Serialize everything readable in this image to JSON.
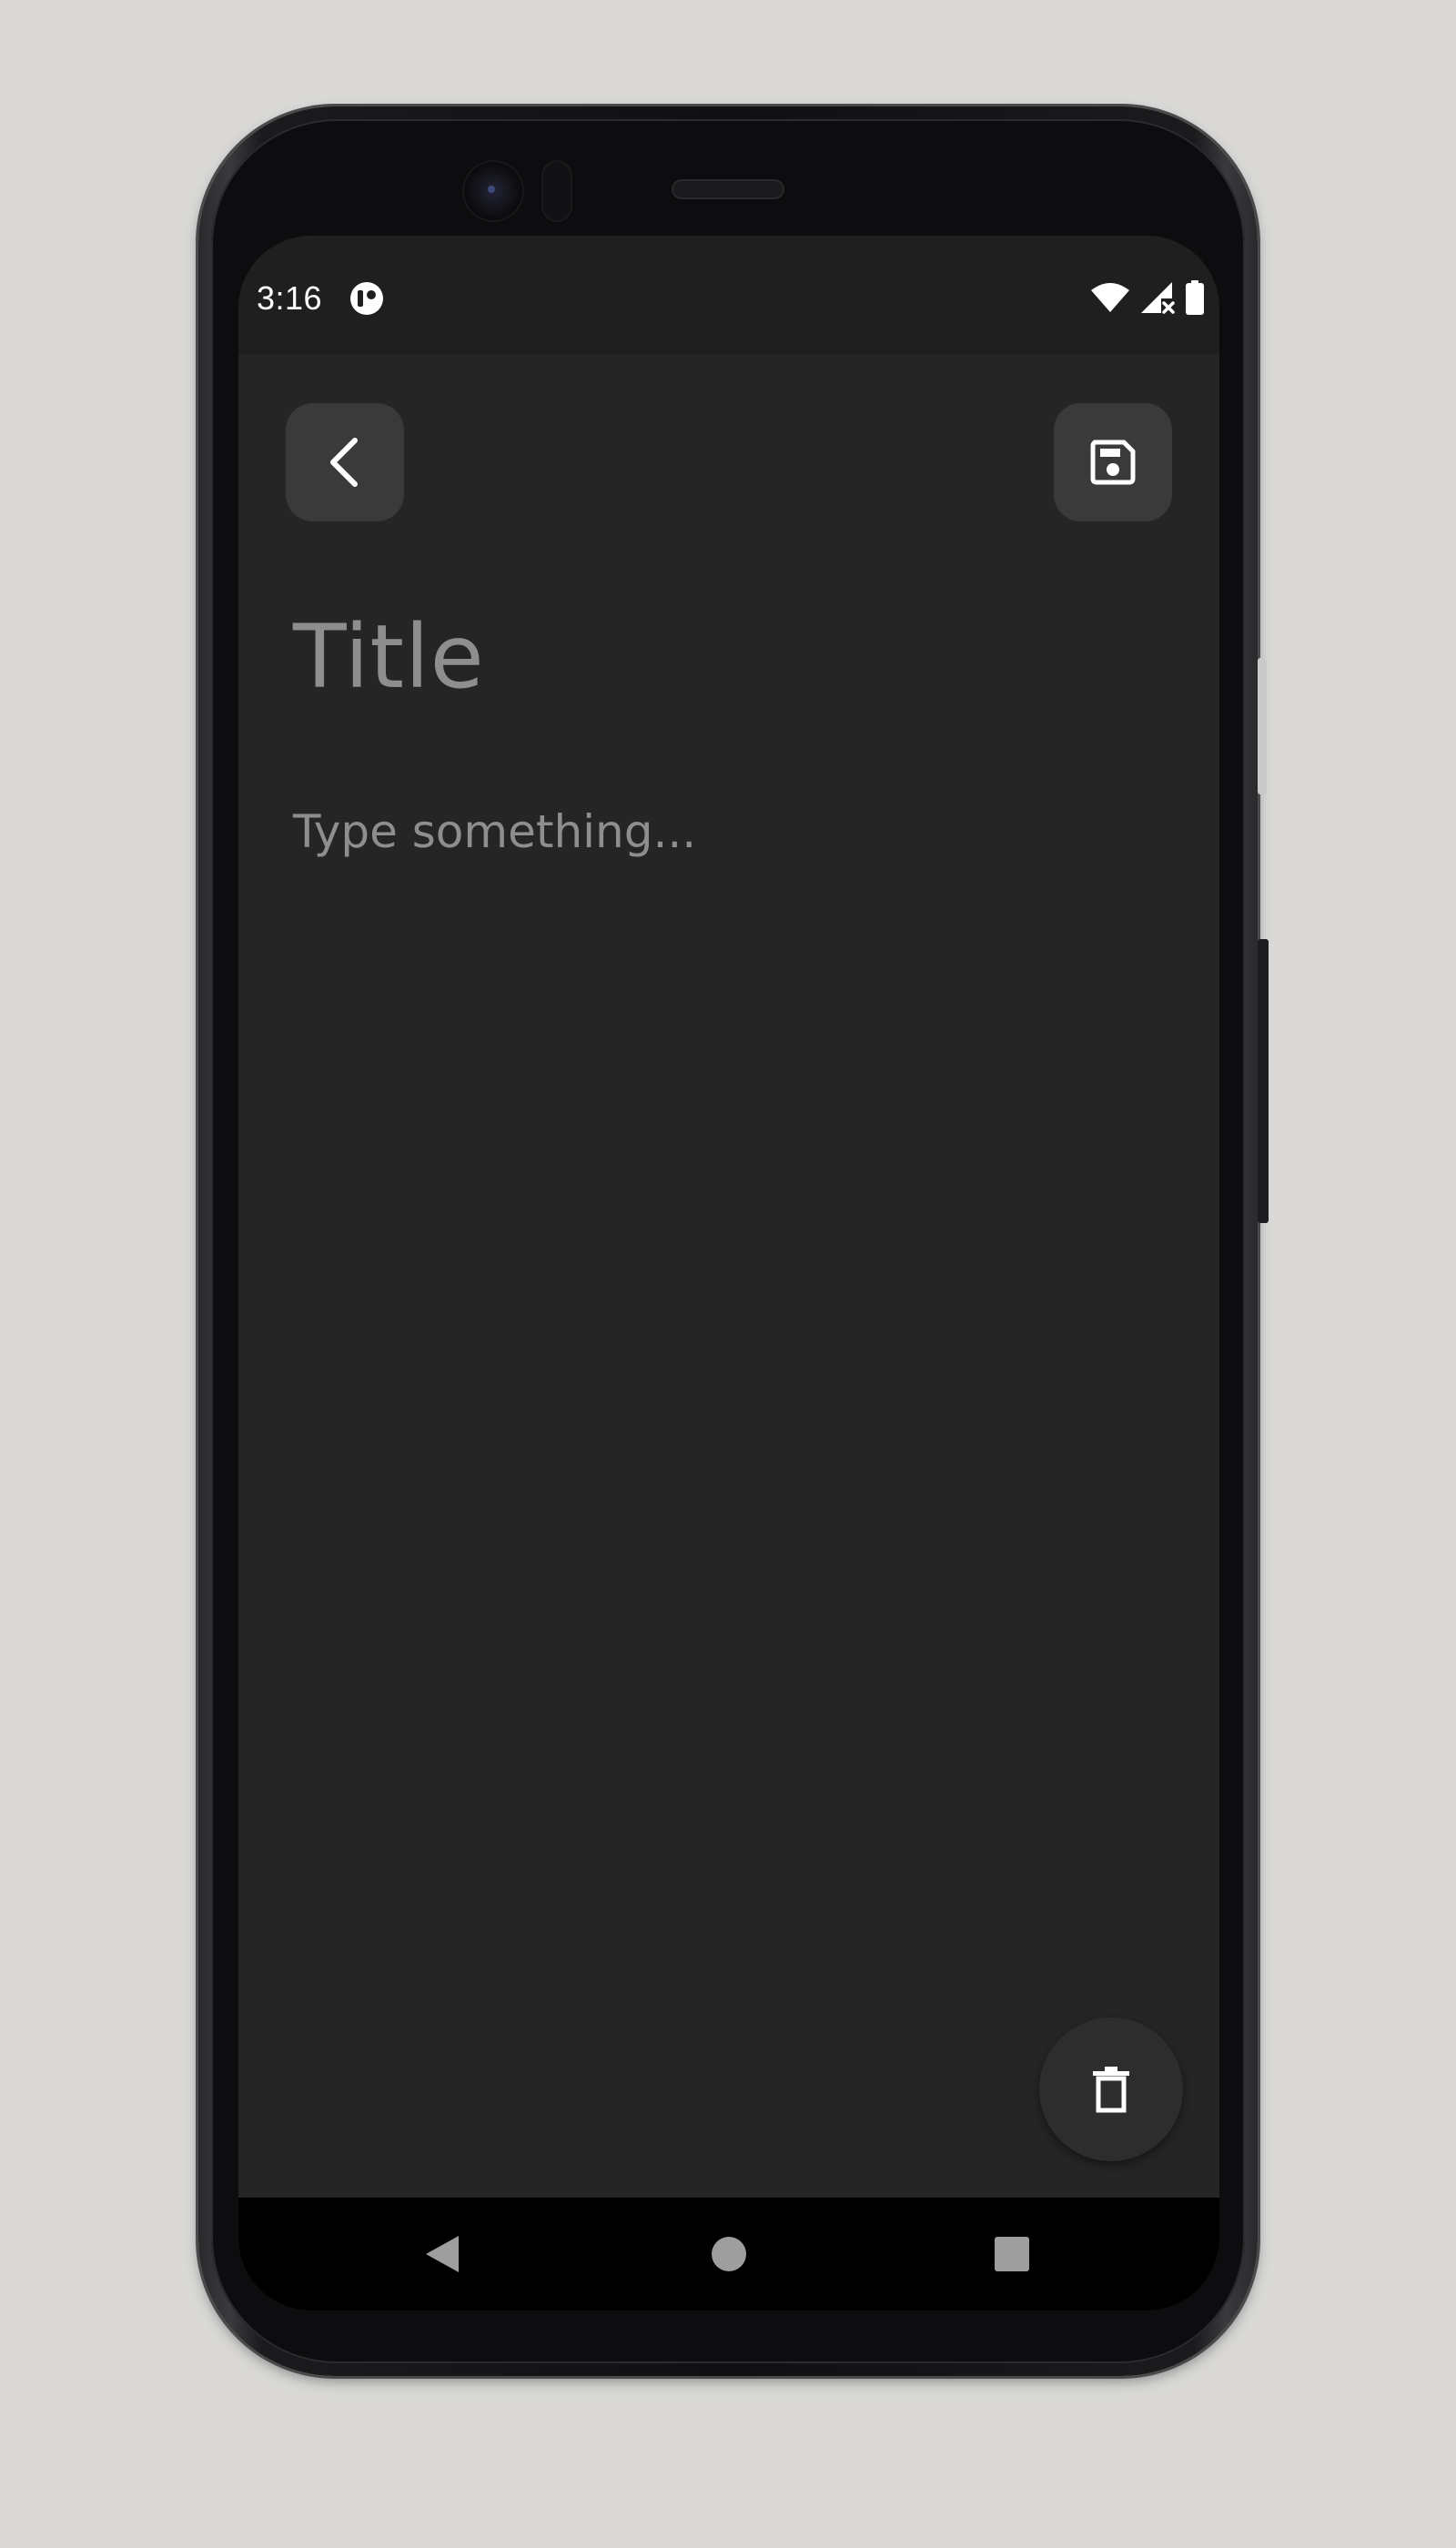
{
  "status_bar": {
    "time": "3:16",
    "app_icon": "app-notification-icon",
    "icons": [
      "wifi-icon",
      "cellular-no-service-icon",
      "battery-icon"
    ]
  },
  "toolbar": {
    "back_icon": "chevron-left-icon",
    "save_icon": "save-icon"
  },
  "note": {
    "title_placeholder": "Title",
    "body_placeholder": "Type something..."
  },
  "fab": {
    "delete_icon": "trash-icon"
  },
  "navigation": {
    "items": [
      "back-triangle-icon",
      "home-circle-icon",
      "recents-square-icon"
    ]
  },
  "colors": {
    "background": "#252525",
    "status_bar": "#1f1f1f",
    "button_surface": "#3a3a3a",
    "placeholder_text": "#8e8e8e",
    "icon": "#ffffff",
    "nav_bar": "#000000",
    "page_background": "#d9d8d6"
  }
}
